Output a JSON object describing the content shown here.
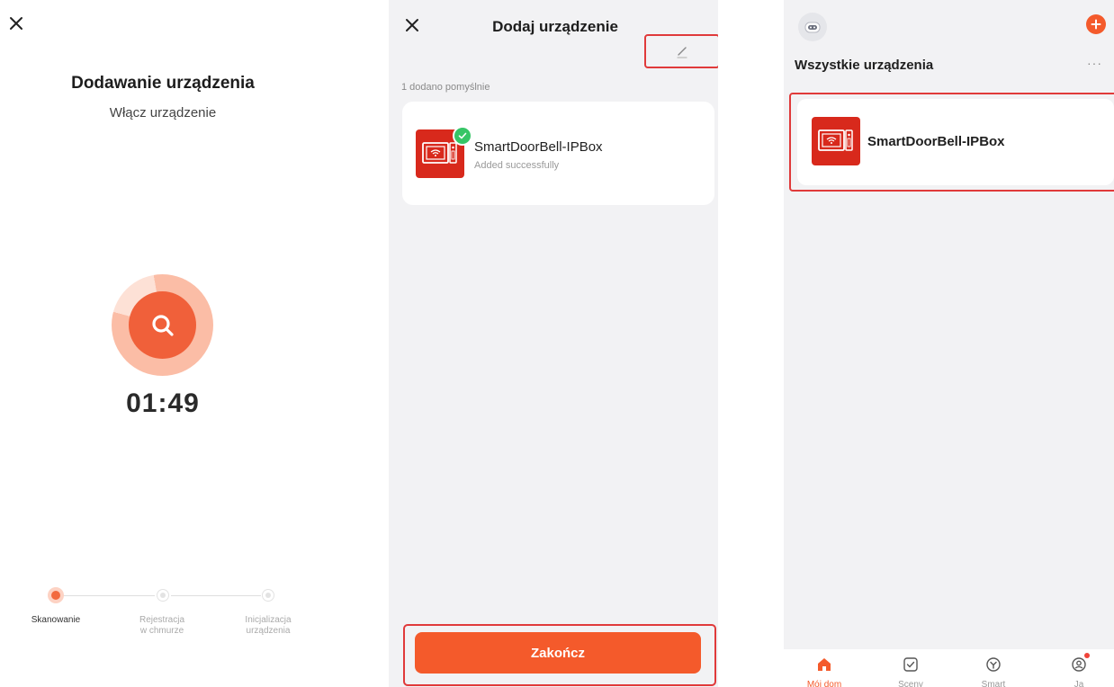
{
  "colors": {
    "accent": "#f45a2b",
    "device_red": "#d8291c",
    "highlight_border": "#e03a3a",
    "success_green": "#36c566",
    "screen_bg": "#f2f2f4"
  },
  "panel_scan": {
    "close_icon": "close-icon",
    "title": "Dodawanie urządzenia",
    "subtitle": "Włącz urządzenie",
    "timer": "01:49",
    "steps": [
      {
        "label": "Skanowanie",
        "state": "active"
      },
      {
        "label": "Rejestracja w chmurze",
        "label_line1": "Rejestracja",
        "label_line2": "w chmurze",
        "state": "inactive"
      },
      {
        "label": "Inicjalizacja urządzenia",
        "label_line1": "Inicjalizacja",
        "label_line2": "urządzenia",
        "state": "inactive"
      }
    ]
  },
  "panel_add": {
    "close_icon": "close-icon",
    "title": "Dodaj urządzenie",
    "success_count": "1 dodano pomyślnie",
    "device": {
      "name": "SmartDoorBell-IPBox",
      "status": "Added successfully",
      "icon": "doorbell-icon"
    },
    "edit_icon": "pencil-icon",
    "finish_label": "Zakończ"
  },
  "panel_home": {
    "section_title": "Wszystkie urządzenia",
    "more_label": "···",
    "device": {
      "name": "SmartDoorBell-IPBox",
      "icon": "doorbell-icon"
    },
    "tabs": [
      {
        "label": "Mój dom",
        "icon": "home-icon",
        "active": true
      },
      {
        "label": "Sceny",
        "icon": "check-square-icon",
        "active": false
      },
      {
        "label": "Smart",
        "icon": "smart-icon",
        "active": false
      },
      {
        "label": "Ja",
        "icon": "user-icon",
        "active": false
      }
    ]
  }
}
